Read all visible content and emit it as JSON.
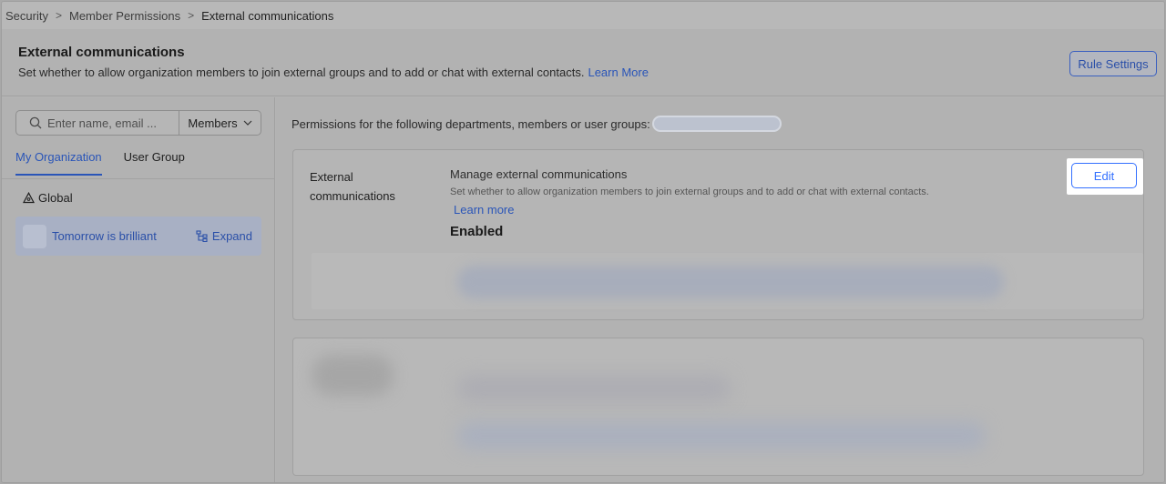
{
  "breadcrumb": {
    "items": [
      "Security",
      "Member Permissions",
      "External communications"
    ]
  },
  "header": {
    "title": "External communications",
    "description": "Set whether to allow organization members to join external groups and to add or chat with external contacts.",
    "learn_more": "Learn More",
    "rule_settings_label": "Rule Settings"
  },
  "sidebar": {
    "search_placeholder": "Enter name, email ...",
    "filter_selected": "Members",
    "tabs": [
      {
        "label": "My Organization",
        "active": true
      },
      {
        "label": "User Group",
        "active": false
      }
    ],
    "global_label": "Global",
    "org_item": {
      "name": "Tomorrow is brilliant",
      "expand_label": "Expand"
    }
  },
  "main": {
    "permissions_label": "Permissions for the following departments, members or user groups:",
    "card": {
      "category": "External communications",
      "setting_title": "Manage external communications",
      "setting_description": "Set whether to allow organization members to join external groups and to add or chat with external contacts.",
      "learn_more": "Learn more",
      "status": "Enabled",
      "edit_label": "Edit"
    }
  },
  "colors": {
    "accent": "#3370ff",
    "link": "#2a55b8",
    "overlay": "#b2b2b2"
  }
}
